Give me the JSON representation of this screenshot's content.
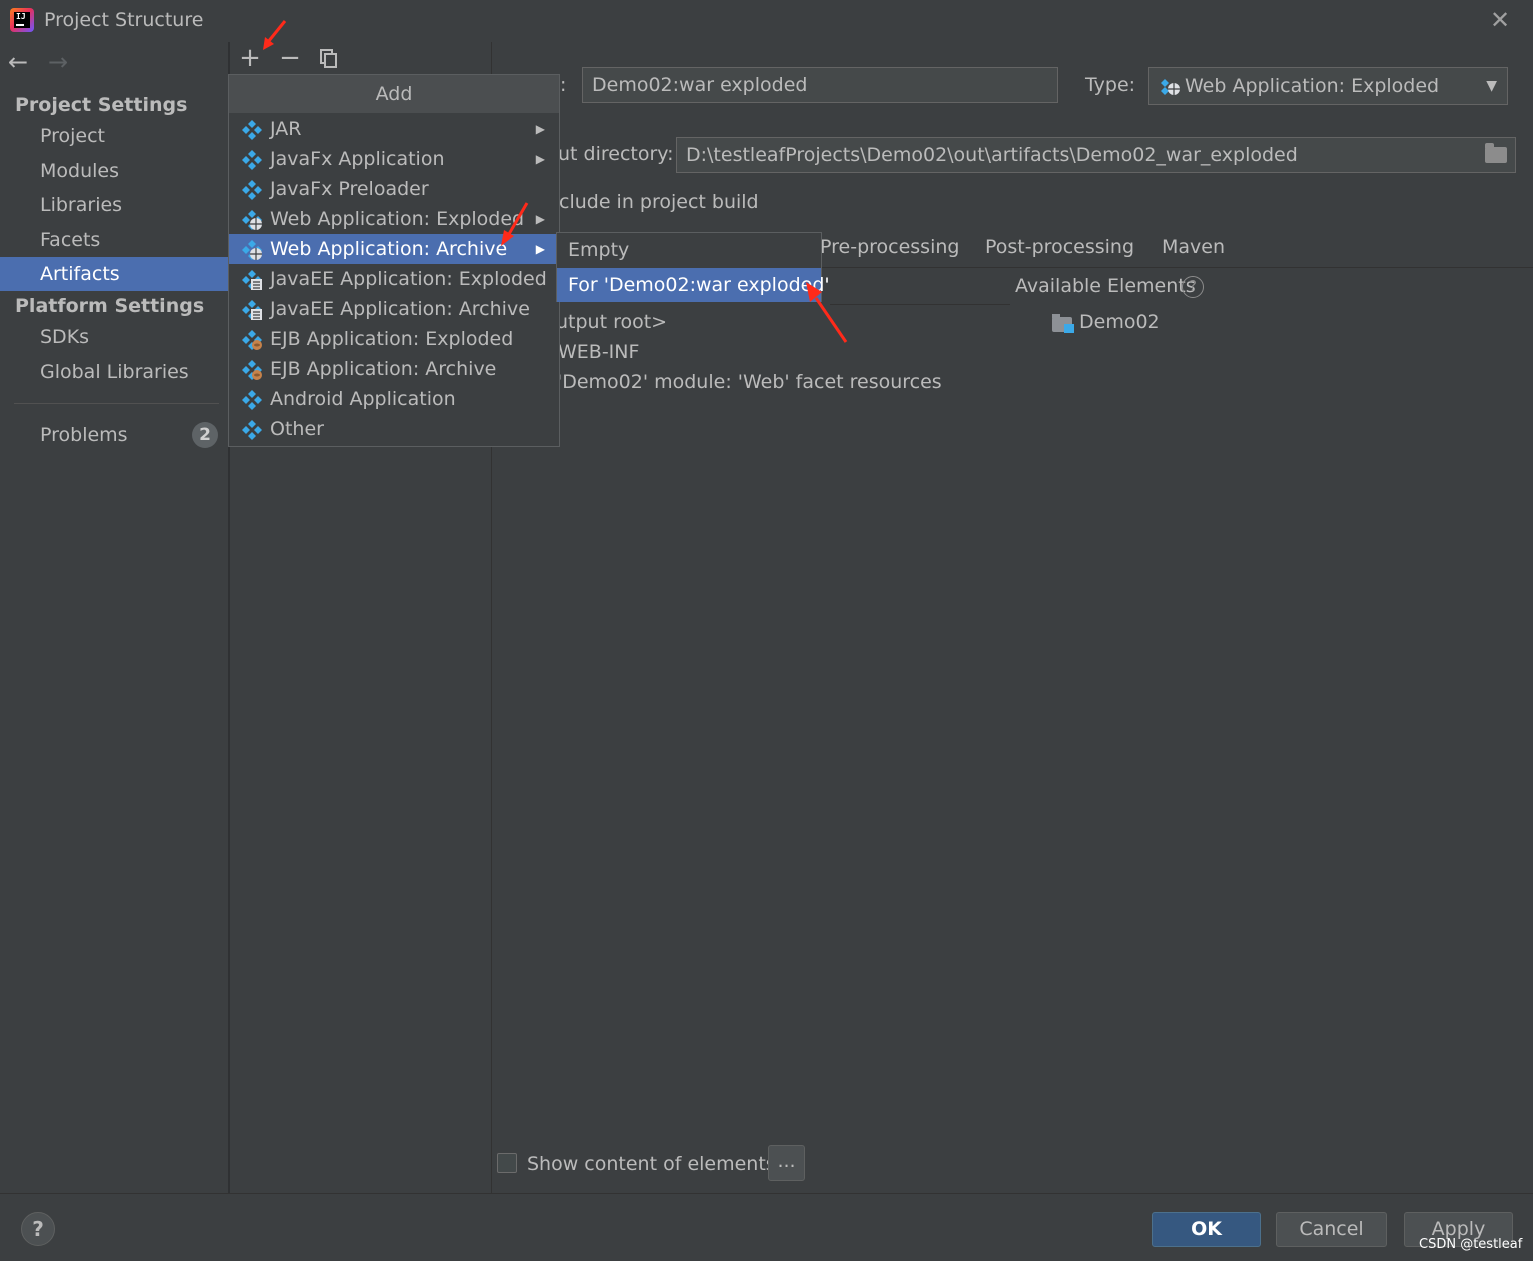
{
  "window": {
    "title": "Project Structure",
    "close_glyph": "✕"
  },
  "nav": {
    "back": "←",
    "forward": "→"
  },
  "sidebar": {
    "project_settings_header": "Project Settings",
    "project_items": [
      "Project",
      "Modules",
      "Libraries",
      "Facets",
      "Artifacts"
    ],
    "selected": "Artifacts",
    "platform_settings_header": "Platform Settings",
    "platform_items": [
      "SDKs",
      "Global Libraries"
    ],
    "problems_label": "Problems",
    "problems_count": "2"
  },
  "toolbar": {
    "add": "+",
    "remove": "−"
  },
  "artifact": {
    "name_label_fragment": ":",
    "name_value": "Demo02:war exploded",
    "type_label": "Type:",
    "type_value": "Web Application: Exploded",
    "output_dir_label_fragment": "ut directory:",
    "output_dir_value": "D:\\testleafProjects\\Demo02\\out\\artifacts\\Demo02_war_exploded",
    "include_build_fragment": "clude in project build",
    "tabs": [
      "Pre-processing",
      "Post-processing",
      "Maven"
    ],
    "tab0_fragment": "Pre-processing",
    "available_elements_label": "Available Elements",
    "help_glyph": "?",
    "tree_items": [
      "utput root>",
      "WEB-INF",
      "'Demo02' module: 'Web' facet resources"
    ],
    "available_tree": [
      "Demo02"
    ],
    "show_content_label": "Show content of elements",
    "dots_label": "..."
  },
  "add_menu": {
    "title": "Add",
    "items": [
      {
        "label": "JAR",
        "has_submenu": true,
        "icon": "artifact-icon"
      },
      {
        "label": "JavaFx Application",
        "has_submenu": true,
        "icon": "artifact-icon"
      },
      {
        "label": "JavaFx Preloader",
        "has_submenu": false,
        "icon": "artifact-icon"
      },
      {
        "label": "Web Application: Exploded",
        "has_submenu": true,
        "icon": "web-artifact-icon"
      },
      {
        "label": "Web Application: Archive",
        "has_submenu": true,
        "icon": "web-artifact-icon"
      },
      {
        "label": "JavaEE Application: Exploded",
        "has_submenu": false,
        "icon": "javaee-artifact-icon"
      },
      {
        "label": "JavaEE Application: Archive",
        "has_submenu": false,
        "icon": "javaee-artifact-icon"
      },
      {
        "label": "EJB Application: Exploded",
        "has_submenu": false,
        "icon": "ejb-artifact-icon"
      },
      {
        "label": "EJB Application: Archive",
        "has_submenu": false,
        "icon": "ejb-artifact-icon"
      },
      {
        "label": "Android Application",
        "has_submenu": false,
        "icon": "artifact-icon"
      },
      {
        "label": "Other",
        "has_submenu": false,
        "icon": "artifact-icon"
      }
    ],
    "highlighted": "Web Application: Archive"
  },
  "sub_menu": {
    "items": [
      "Empty",
      "For 'Demo02:war exploded'"
    ],
    "highlighted": "For 'Demo02:war exploded'"
  },
  "buttons": {
    "help": "?",
    "ok": "OK",
    "cancel": "Cancel",
    "apply": "Apply"
  },
  "watermark": "CSDN @testleaf",
  "colors": {
    "background": "#3c3f41",
    "selection": "#4b6eaf",
    "ok_button": "#365880",
    "annotation_arrow": "#ff2a1a",
    "artifact_icon": "#3ba9e8"
  }
}
